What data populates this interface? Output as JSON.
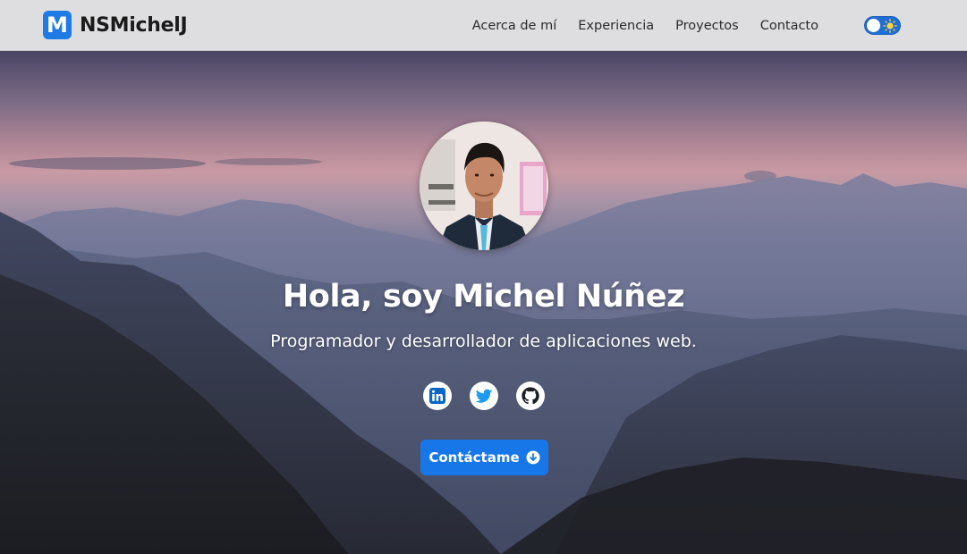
{
  "brand": {
    "logo_letter": "M",
    "name": "NSMichelJ",
    "color": "#1e7be6"
  },
  "nav": {
    "links": [
      {
        "label": "Acerca de mí"
      },
      {
        "label": "Experiencia"
      },
      {
        "label": "Proyectos"
      },
      {
        "label": "Contacto"
      }
    ],
    "theme_toggle": {
      "icon": "sun-icon",
      "state": "light"
    }
  },
  "hero": {
    "title": "Hola, soy Michel Núñez",
    "subtitle": "Programador y desarrollador de aplicaciones web.",
    "socials": [
      {
        "icon": "linkedin-icon"
      },
      {
        "icon": "twitter-icon"
      },
      {
        "icon": "github-icon"
      }
    ],
    "cta": {
      "label": "Contáctame",
      "icon": "arrow-down-circle-icon",
      "color": "#1777e8"
    }
  }
}
